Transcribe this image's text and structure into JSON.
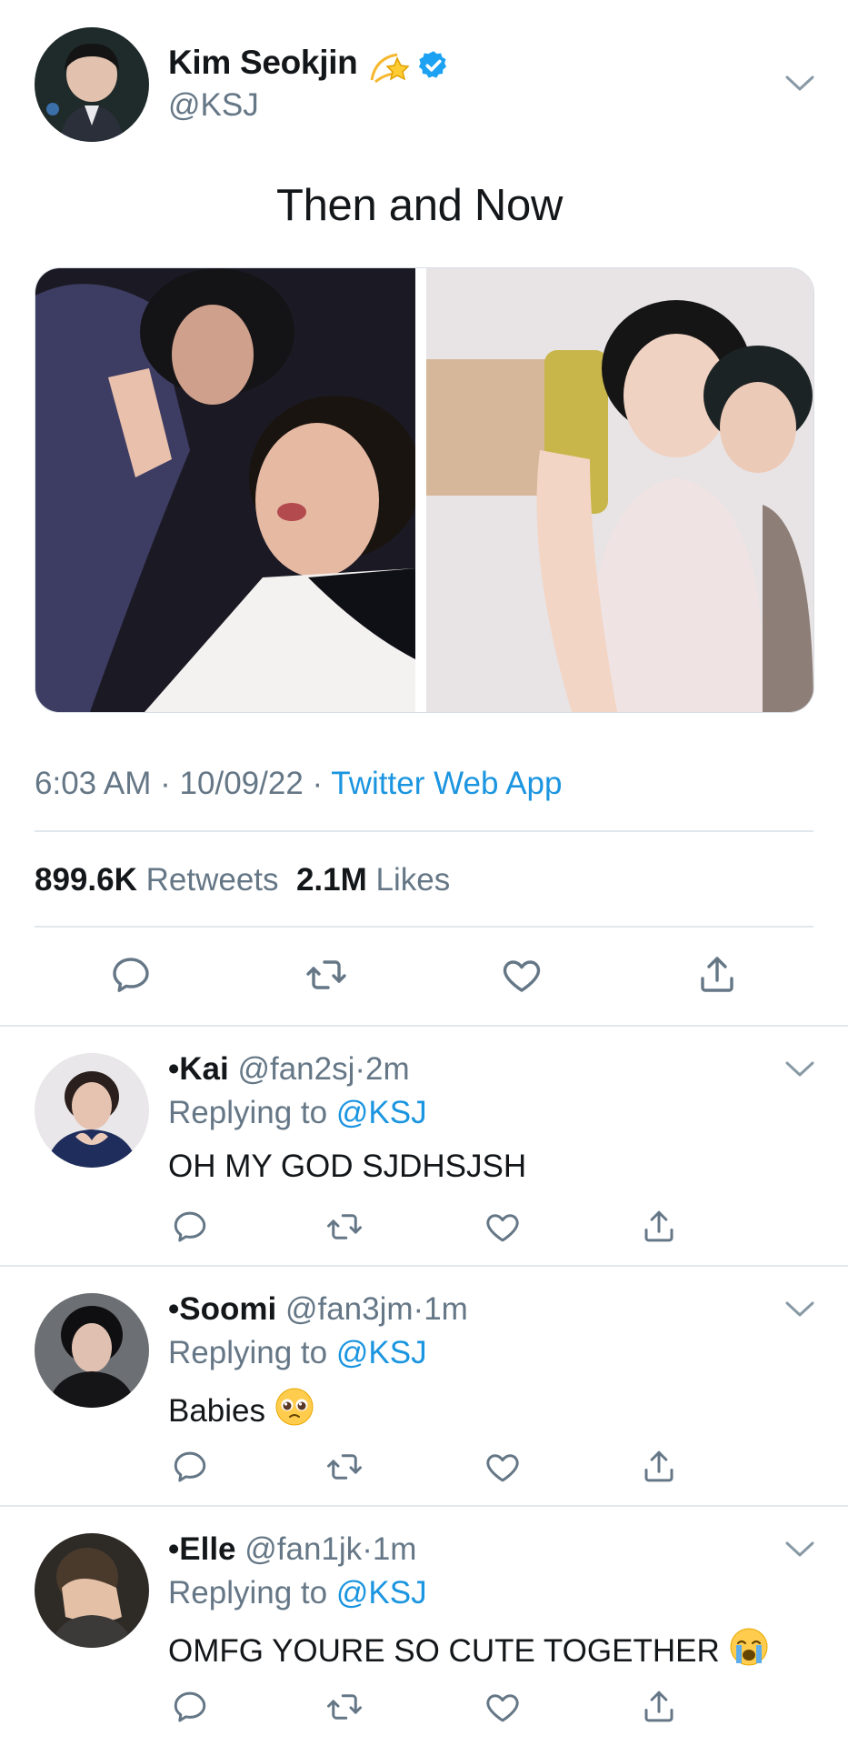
{
  "tweet": {
    "author_name": "Kim Seokjin",
    "author_handle": "@KSJ",
    "name_emoji": "dizzy-star-emoji",
    "verified": true,
    "text": "Then and Now",
    "time": "6:03 AM",
    "date": "10/09/22",
    "source": "Twitter Web App",
    "retweets": "899.6K",
    "retweets_label": "Retweets",
    "likes": "2.1M",
    "likes_label": "Likes",
    "media_count": 2
  },
  "actions": [
    "reply-icon",
    "retweet-icon",
    "like-icon",
    "share-icon"
  ],
  "replies": [
    {
      "name": "•Kai",
      "handle": "@fan2sj",
      "time": "2m",
      "replying_prefix": "Replying to",
      "replying_to": "@KSJ",
      "text": "OH MY GOD SJDHSJSH",
      "emoji": ""
    },
    {
      "name": "•Soomi",
      "handle": "@fan3jm",
      "time": "1m",
      "replying_prefix": "Replying to",
      "replying_to": "@KSJ",
      "text": "Babies",
      "emoji": "pleading-face-emoji"
    },
    {
      "name": "•Elle",
      "handle": "@fan1jk",
      "time": "1m",
      "replying_prefix": "Replying to",
      "replying_to": "@KSJ",
      "text": "OMFG YOURE SO CUTE TOGETHER",
      "emoji": "crying-face-emoji"
    }
  ],
  "colors": {
    "link": "#1b95e0",
    "muted": "#657786",
    "text": "#14171a",
    "divider": "#e1e8ed",
    "verified": "#1da1f2"
  }
}
